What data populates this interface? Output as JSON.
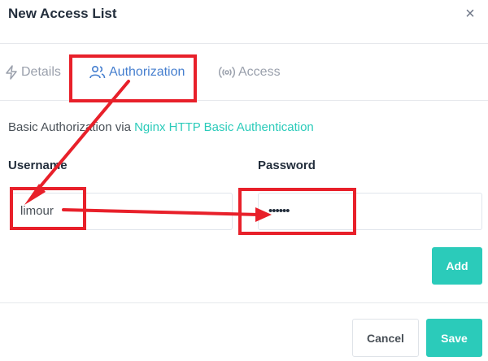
{
  "modal": {
    "title": "New Access List",
    "close_glyph": "×"
  },
  "tabs": [
    {
      "label": "Details",
      "icon": "lightning-icon",
      "active": false
    },
    {
      "label": "Authorization",
      "icon": "users-icon",
      "active": true
    },
    {
      "label": "Access",
      "icon": "broadcast-icon",
      "active": false
    }
  ],
  "auth": {
    "intro_text": "Basic Authorization via ",
    "intro_link": "Nginx HTTP Basic Authentication",
    "username_label": "Username",
    "password_label": "Password",
    "username_value": "limour",
    "password_value": "••••••",
    "add_label": "Add"
  },
  "footer": {
    "cancel_label": "Cancel",
    "save_label": "Save"
  },
  "colors": {
    "accent_blue": "#467fcf",
    "teal": "#2bcbba",
    "annotation_red": "#e8202a"
  }
}
